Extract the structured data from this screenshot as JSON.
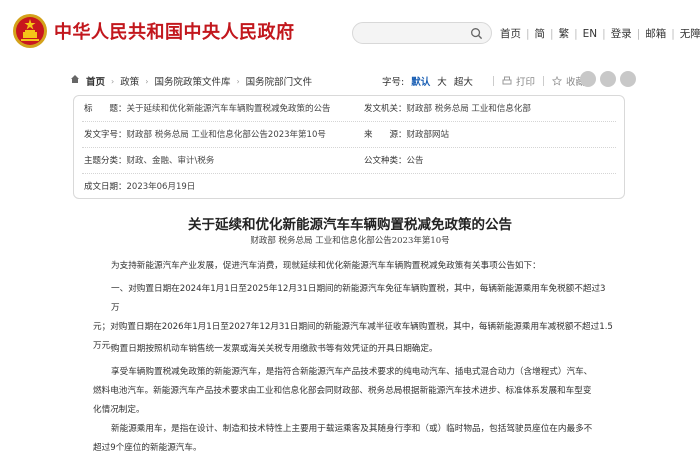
{
  "header": {
    "site_title": "中华人民共和国中央人民政府",
    "links": [
      "首页",
      "简",
      "繁",
      "EN",
      "登录",
      "邮箱",
      "无障碍"
    ]
  },
  "breadcrumb": {
    "items": [
      "首页",
      "政策",
      "国务院政策文件库",
      "国务院部门文件"
    ],
    "font_size_label": "字号:",
    "font_sizes": [
      "默认",
      "大",
      "超大"
    ],
    "print_label": "打印",
    "favorite_label": "收藏",
    "colors": {
      "active_size": "#1a5fb4"
    }
  },
  "info": {
    "title_label": "标　　题：",
    "title_value": "关于延续和优化新能源汽车车辆购置税减免政策的公告",
    "issuer_label": "发文机关：",
    "issuer_value": "财政部 税务总局 工业和信息化部",
    "doc_no_label": "发文字号：",
    "doc_no_value": "财政部 税务总局 工业和信息化部公告2023年第10号",
    "source_label": "来　　源：",
    "source_value": "财政部网站",
    "topic_label": "主题分类：",
    "topic_value": "财政、金融、审计\\税务",
    "type_label": "公文种类：",
    "type_value": "公告",
    "date_label": "成文日期：",
    "date_value": "2023年06月19日"
  },
  "document": {
    "title": "关于延续和优化新能源汽车车辆购置税减免政策的公告",
    "subtitle": "财政部  税务总局  工业和信息化部公告2023年第10号",
    "p1": "为支持新能源汽车产业发展，促进汽车消费，现就延续和优化新能源汽车车辆购置税减免政策有关事项公告如下：",
    "p2_line1": "一、对购置日期在2024年1月1日至2025年12月31日期间的新能源汽车免征车辆购置税，其中，每辆新能源乘用车免税额不超过3万",
    "p2_line2": "元；对购置日期在2026年1月1日至2027年12月31日期间的新能源汽车减半征收车辆购置税，其中，每辆新能源乘用车减税额不超过1.5",
    "p2_line3": "万元。",
    "p3": "购置日期按照机动车销售统一发票或海关关税专用缴款书等有效凭证的开具日期确定。",
    "p4_line1": "享受车辆购置税减免政策的新能源汽车，是指符合新能源汽车产品技术要求的纯电动汽车、插电式混合动力（含增程式）汽车、",
    "p4_line2": "燃料电池汽车。新能源汽车产品技术要求由工业和信息化部会同财政部、税务总局根据新能源汽车技术进步、标准体系发展和车型变",
    "p4_line3": "化情况制定。",
    "p5_line1": "新能源乘用车，是指在设计、制造和技术特性上主要用于载运乘客及其随身行李和（或）临时物品，包括驾驶员座位在内最多不",
    "p5_line2": "超过9个座位的新能源汽车。"
  }
}
